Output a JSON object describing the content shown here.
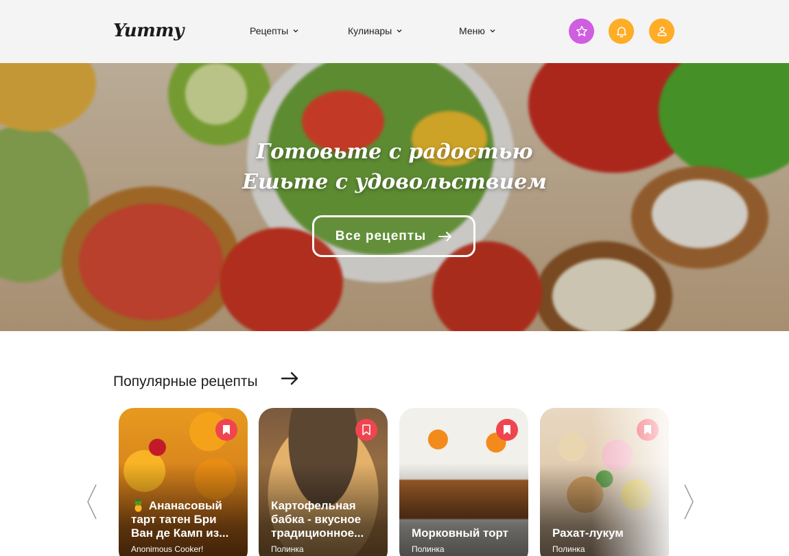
{
  "app": {
    "logo": "Yummy"
  },
  "nav": [
    {
      "label": "Рецепты"
    },
    {
      "label": "Кулинары"
    },
    {
      "label": "Меню"
    }
  ],
  "header_buttons": {
    "favorites_color": "#d05ee0",
    "notifications_color": "#ffac26",
    "profile_color": "#ffac26"
  },
  "hero": {
    "line1": "Готовьте с радостью",
    "line2": "Ешьте с удовольствием",
    "button_label": "Все рецепты"
  },
  "popular": {
    "title": "Популярные рецепты",
    "cards": [
      {
        "title": "🍍 Ананасовый тарт татен Бри Ван де Камп из...",
        "author": "Anonimous Cooker!"
      },
      {
        "title": "Картофельная бабка - вкусное традиционное...",
        "author": "Полинка"
      },
      {
        "title": "Морковный торт",
        "author": "Полинка"
      },
      {
        "title": "Рахат-лукум",
        "author": "Полинка"
      }
    ]
  },
  "colors": {
    "accent_orange": "#ffac26",
    "accent_purple": "#d05ee0",
    "bookmark_red": "#f0454f"
  }
}
